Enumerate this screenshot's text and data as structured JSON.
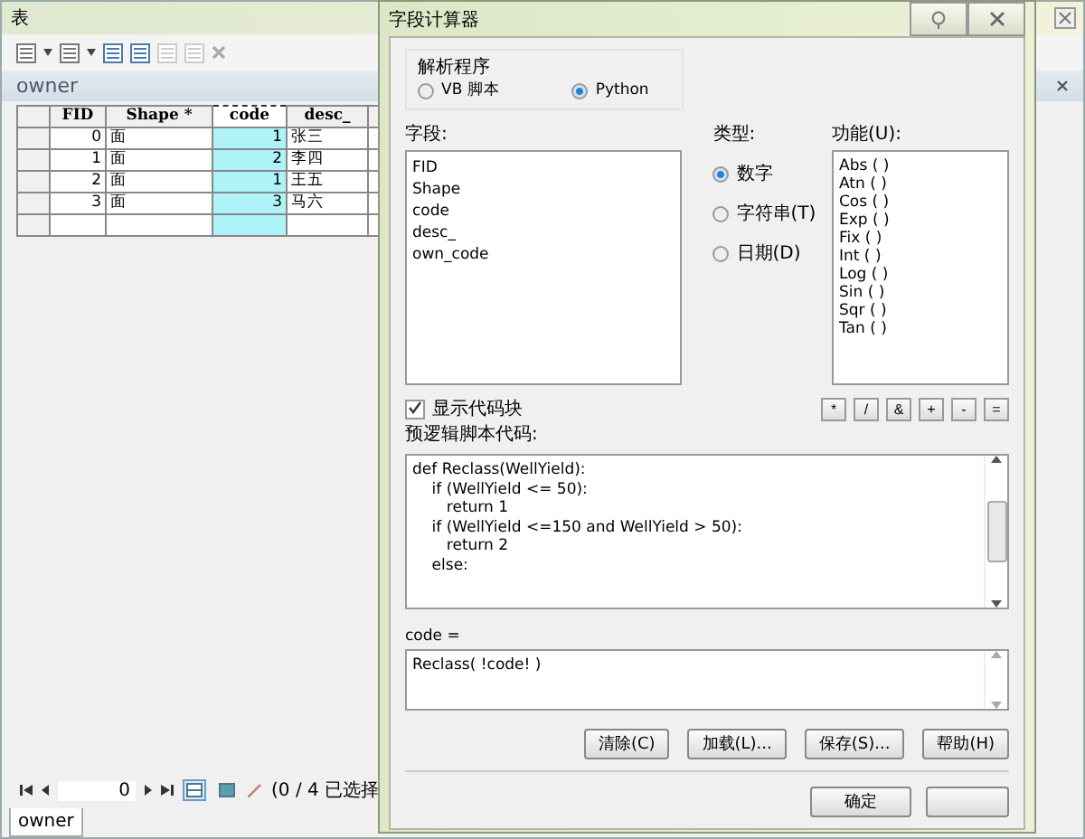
{
  "table_window": {
    "title": "表",
    "layer_tab": "owner",
    "columns": [
      {
        "label": "FID",
        "kind": "number",
        "selected": false
      },
      {
        "label": "Shape *",
        "kind": "text",
        "selected": false
      },
      {
        "label": "code",
        "kind": "number",
        "selected": true
      },
      {
        "label": "desc_",
        "kind": "text",
        "selected": false
      }
    ],
    "rows": [
      [
        "0",
        "面",
        "1",
        "张三"
      ],
      [
        "1",
        "面",
        "2",
        "李四"
      ],
      [
        "2",
        "面",
        "1",
        "王五"
      ],
      [
        "3",
        "面",
        "3",
        "马六"
      ]
    ],
    "record_number": "0",
    "views": [
      {
        "selected": true
      },
      {
        "selected": false
      }
    ],
    "selection_status": "(0 / 4 已选择",
    "bottom_tab": "owner"
  },
  "dialog": {
    "title": "字段计算器",
    "parser": {
      "label": "解析程序",
      "options": [
        {
          "label": "VB 脚本",
          "selected": false
        },
        {
          "label": "Python",
          "selected": true
        }
      ]
    },
    "fields": {
      "label": "字段:",
      "items": [
        "FID",
        "Shape",
        "code",
        "desc_",
        "own_code"
      ]
    },
    "type": {
      "label": "类型:",
      "options": [
        {
          "label": "数字",
          "selected": true
        },
        {
          "label": "字符串(T)",
          "selected": false
        },
        {
          "label": "日期(D)",
          "selected": false
        }
      ]
    },
    "functions": {
      "label": "功能(U):",
      "items": [
        "Abs ( )",
        "Atn ( )",
        "Cos ( )",
        "Exp ( )",
        "Fix ( )",
        "Int ( )",
        "Log ( )",
        "Sin ( )",
        "Sqr ( )",
        "Tan ( )"
      ]
    },
    "show_codeblock": {
      "label": "显示代码块",
      "checked": true
    },
    "operators": [
      "*",
      "/",
      "&",
      "+",
      "-",
      "="
    ],
    "codeblock": {
      "label": "预逻辑脚本代码:",
      "lines": [
        "def Reclass(WellYield):",
        "    if (WellYield <= 50):",
        "       return 1",
        "    if (WellYield <=150 and WellYield > 50):",
        "       return 2",
        "    else:"
      ]
    },
    "expression": {
      "label": "code =",
      "value": "Reclass( !code! )"
    },
    "buttons": [
      "清除(C)",
      "加载(L)...",
      "保存(S)...",
      "帮助(H)"
    ],
    "ok_button": "确定"
  }
}
